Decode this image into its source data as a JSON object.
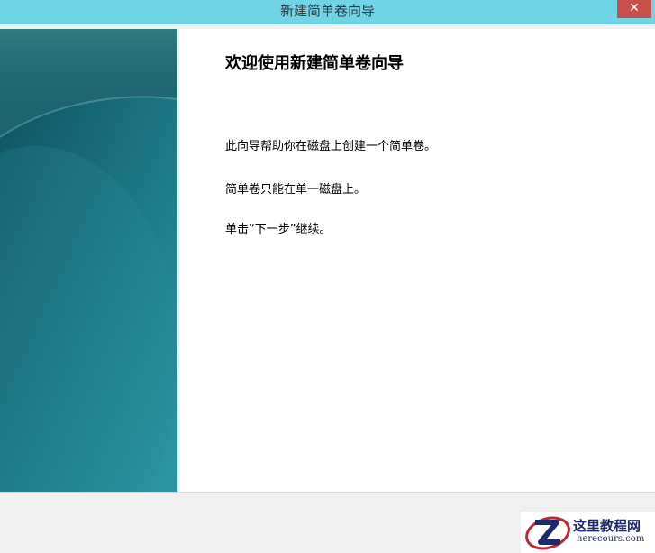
{
  "window": {
    "title": "新建简单卷向导",
    "close_symbol": "✕"
  },
  "wizard": {
    "heading": "欢迎使用新建简单卷向导",
    "paragraphs": [
      "此向导帮助你在磁盘上创建一个简单卷。",
      "简单卷只能在单一磁盘上。",
      "单击“下一步”继续。"
    ]
  },
  "watermark": {
    "title": "这里教程网",
    "url": "herecours.com",
    "logo_letter": "Z"
  },
  "icons": {
    "close": "close-icon",
    "logo": "site-logo-icon"
  },
  "colors": {
    "titlebar": "#6ed4e6",
    "close_button": "#c7504a",
    "side_panel": "#1b7b85"
  }
}
